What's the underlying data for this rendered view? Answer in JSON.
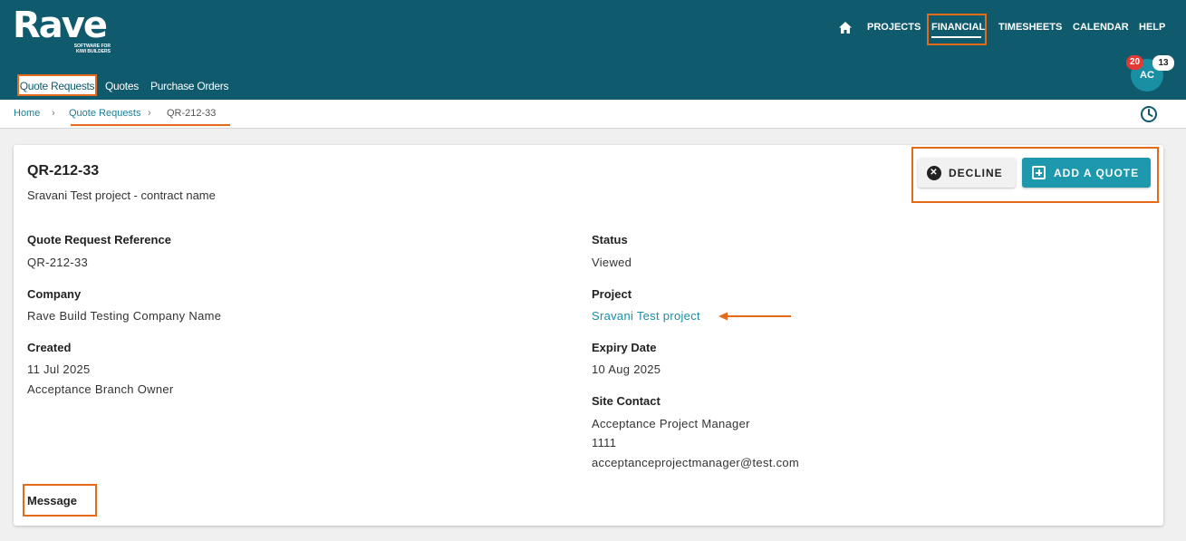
{
  "app": {
    "logo_word": "Rave",
    "logo_tagline_1": "SOFTWARE FOR",
    "logo_tagline_2": "KIWI BUILDERS"
  },
  "nav": {
    "home_icon": "home-icon",
    "items": [
      "PROJECTS",
      "FINANCIAL",
      "TIMESHEETS",
      "CALENDAR",
      "HELP"
    ],
    "active": "FINANCIAL"
  },
  "subtabs": {
    "items": [
      "Quote Requests",
      "Quotes",
      "Purchase Orders"
    ],
    "active": "Quote Requests"
  },
  "user": {
    "initials": "AC",
    "badge_red": "20",
    "badge_white": "13"
  },
  "breadcrumb": {
    "home": "Home",
    "quote_requests": "Quote Requests",
    "current": "QR-212-33"
  },
  "detail": {
    "title": "QR-212-33",
    "subtitle": "Sravani Test project - contract name",
    "decline_label": "DECLINE",
    "add_quote_label": "ADD A QUOTE",
    "fields": {
      "reference_label": "Quote Request Reference",
      "reference_value": "QR-212-33",
      "company_label": "Company",
      "company_value": "Rave Build Testing Company Name",
      "created_label": "Created",
      "created_date": "11 Jul 2025",
      "created_by": "Acceptance Branch Owner",
      "status_label": "Status",
      "status_value": "Viewed",
      "project_label": "Project",
      "project_value": "Sravani Test project",
      "expiry_label": "Expiry Date",
      "expiry_value": "10 Aug 2025",
      "site_contact_label": "Site Contact",
      "site_contact_name": "Acceptance Project Manager",
      "site_contact_phone": "1111",
      "site_contact_email": "acceptanceprojectmanager@test.com",
      "message_label": "Message"
    }
  },
  "colors": {
    "header": "#0f5a6c",
    "accent": "#1e98ad",
    "highlight": "#e56a1a",
    "badge_red": "#e53935"
  }
}
